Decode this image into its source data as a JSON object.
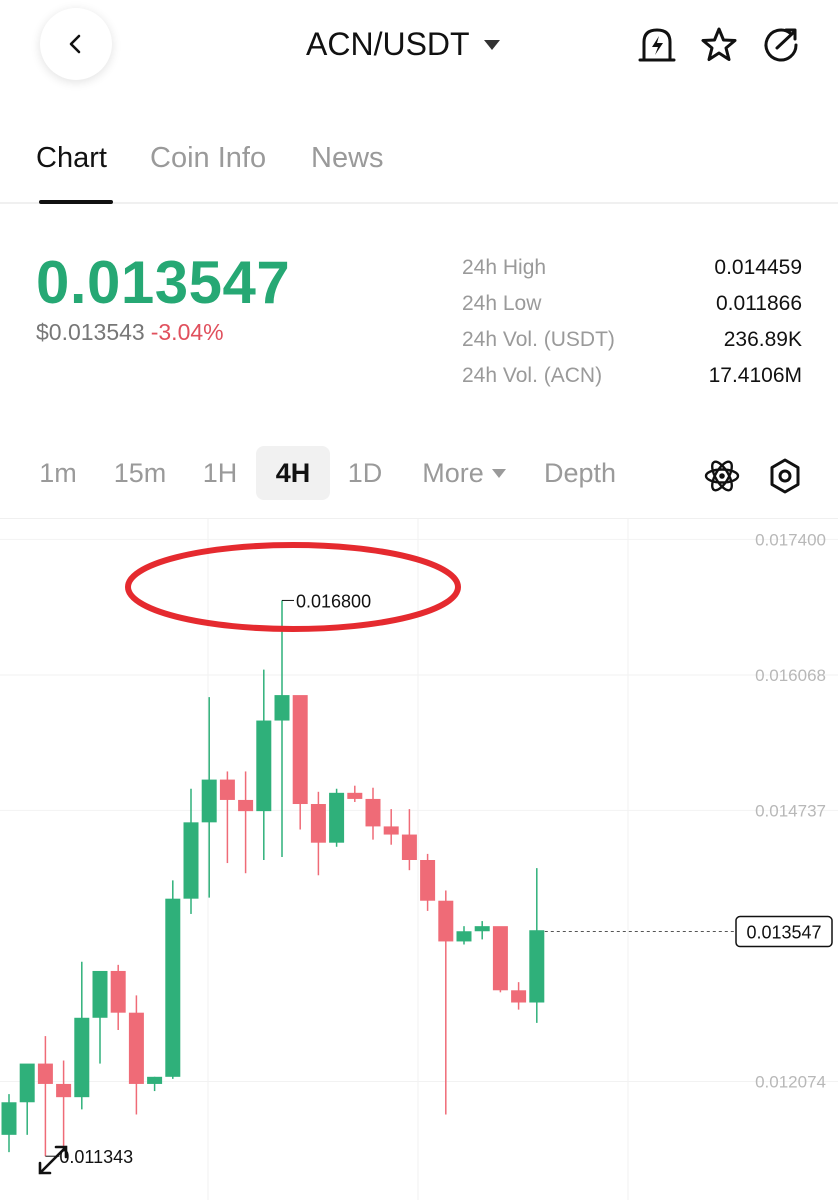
{
  "header": {
    "pair": "ACN/USDT",
    "icons": [
      "back-chevron-icon",
      "price-alert-icon",
      "star-icon",
      "share-icon"
    ]
  },
  "tabs": [
    {
      "label": "Chart",
      "active": true
    },
    {
      "label": "Coin Info",
      "active": false
    },
    {
      "label": "News",
      "active": false
    }
  ],
  "price": {
    "last": "0.013547",
    "usd": "$0.013543",
    "change": "-3.04%"
  },
  "stats": [
    {
      "label": "24h High",
      "value": "0.014459"
    },
    {
      "label": "24h Low",
      "value": "0.011866"
    },
    {
      "label": "24h Vol. (USDT)",
      "value": "236.89K"
    },
    {
      "label": "24h Vol. (ACN)",
      "value": "17.4106M"
    }
  ],
  "intervals": {
    "items": [
      "1m",
      "15m",
      "1H",
      "4H",
      "1D",
      "More",
      "Depth"
    ],
    "active": "4H"
  },
  "colors": {
    "up": "#2fb07a",
    "down": "#ef6b77",
    "price_green": "#26a874",
    "annotation": "#e52a2f"
  },
  "chart_data": {
    "type": "candlestick",
    "y_ticks": [
      "0.017400",
      "0.016068",
      "0.014737",
      "0.012074"
    ],
    "ylim": [
      0.0109,
      0.0176
    ],
    "current_price": "0.013547",
    "max_label": "0.016800",
    "min_label": "0.011343",
    "candles": [
      {
        "o": 0.01155,
        "h": 0.01195,
        "l": 0.01138,
        "c": 0.01187
      },
      {
        "o": 0.01187,
        "h": 0.01215,
        "l": 0.01155,
        "c": 0.01225
      },
      {
        "o": 0.01225,
        "h": 0.01252,
        "l": 0.01134,
        "c": 0.01205
      },
      {
        "o": 0.01205,
        "h": 0.01228,
        "l": 0.0114,
        "c": 0.01192
      },
      {
        "o": 0.01192,
        "h": 0.01325,
        "l": 0.0118,
        "c": 0.0127
      },
      {
        "o": 0.0127,
        "h": 0.01315,
        "l": 0.01225,
        "c": 0.01316
      },
      {
        "o": 0.01316,
        "h": 0.01322,
        "l": 0.01258,
        "c": 0.01275
      },
      {
        "o": 0.01275,
        "h": 0.01292,
        "l": 0.01175,
        "c": 0.01205
      },
      {
        "o": 0.01205,
        "h": 0.01212,
        "l": 0.01198,
        "c": 0.01212
      },
      {
        "o": 0.01212,
        "h": 0.01405,
        "l": 0.0121,
        "c": 0.01387
      },
      {
        "o": 0.01387,
        "h": 0.01495,
        "l": 0.01372,
        "c": 0.01462
      },
      {
        "o": 0.01462,
        "h": 0.01585,
        "l": 0.01388,
        "c": 0.01504
      },
      {
        "o": 0.01504,
        "h": 0.01512,
        "l": 0.01422,
        "c": 0.01484
      },
      {
        "o": 0.01484,
        "h": 0.01512,
        "l": 0.01412,
        "c": 0.01473
      },
      {
        "o": 0.01473,
        "h": 0.01612,
        "l": 0.01425,
        "c": 0.01562
      },
      {
        "o": 0.01562,
        "h": 0.0168,
        "l": 0.01428,
        "c": 0.01587
      },
      {
        "o": 0.01587,
        "h": 0.01585,
        "l": 0.01455,
        "c": 0.0148
      },
      {
        "o": 0.0148,
        "h": 0.01492,
        "l": 0.0141,
        "c": 0.01442
      },
      {
        "o": 0.01442,
        "h": 0.01495,
        "l": 0.01438,
        "c": 0.01491
      },
      {
        "o": 0.01491,
        "h": 0.01498,
        "l": 0.01482,
        "c": 0.01485
      },
      {
        "o": 0.01485,
        "h": 0.01496,
        "l": 0.01445,
        "c": 0.01458
      },
      {
        "o": 0.01458,
        "h": 0.01475,
        "l": 0.0144,
        "c": 0.0145
      },
      {
        "o": 0.0145,
        "h": 0.01475,
        "l": 0.01415,
        "c": 0.01425
      },
      {
        "o": 0.01425,
        "h": 0.01431,
        "l": 0.01375,
        "c": 0.01385
      },
      {
        "o": 0.01385,
        "h": 0.01395,
        "l": 0.01175,
        "c": 0.01345
      },
      {
        "o": 0.01345,
        "h": 0.0136,
        "l": 0.01342,
        "c": 0.01355
      },
      {
        "o": 0.01355,
        "h": 0.01365,
        "l": 0.01347,
        "c": 0.0136
      },
      {
        "o": 0.0136,
        "h": 0.01355,
        "l": 0.01295,
        "c": 0.01297
      },
      {
        "o": 0.01297,
        "h": 0.01305,
        "l": 0.01278,
        "c": 0.01285
      },
      {
        "o": 0.01285,
        "h": 0.01417,
        "l": 0.01265,
        "c": 0.01356
      }
    ]
  }
}
